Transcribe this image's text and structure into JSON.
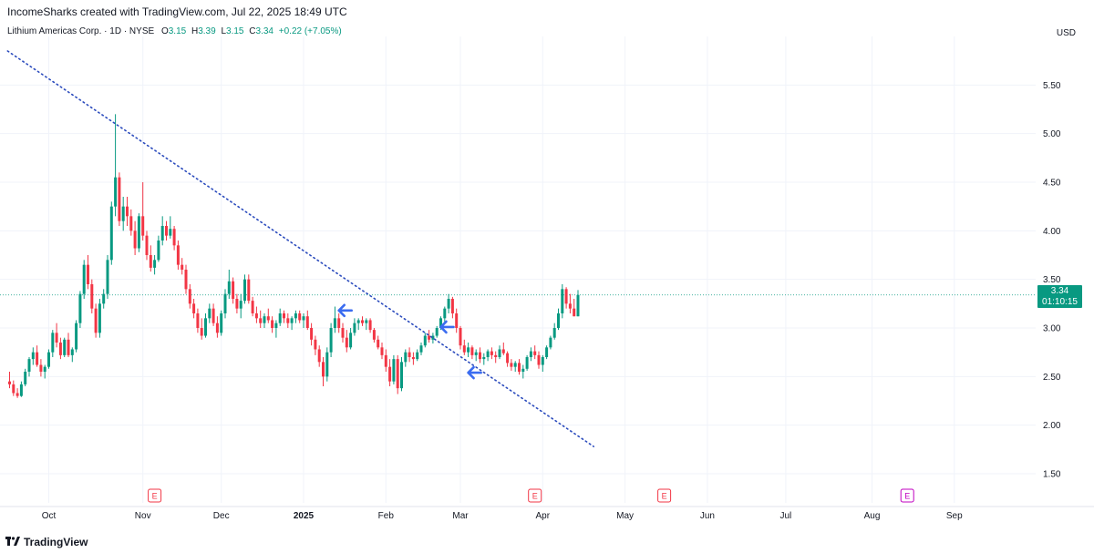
{
  "header": {
    "credit": "IncomeSharks created with TradingView.com, Jul 22, 2025 18:49 UTC",
    "symbol": "Lithium Americas Corp. · 1D · NYSE",
    "o_label": "O",
    "o_value": "3.15",
    "h_label": "H",
    "h_value": "3.39",
    "l_label": "L",
    "l_value": "3.15",
    "c_label": "C",
    "c_value": "3.34",
    "change": "+0.22 (+7.05%)",
    "currency": "USD"
  },
  "price_label": {
    "price": "3.34",
    "countdown": "01:10:15"
  },
  "footer": {
    "brand": "TradingView"
  },
  "colors": {
    "up": "#089981",
    "down": "#f23645",
    "trendline": "#2b4bbd",
    "arrows": "#3b6cf0",
    "earnings": "#f23645",
    "earnings_future": "#c000c0"
  },
  "chart_data": {
    "type": "candlestick",
    "ylim": [
      1.2,
      6.0
    ],
    "y_ticks": [
      "1.50",
      "2.00",
      "2.50",
      "3.00",
      "3.50",
      "4.00",
      "4.50",
      "5.00",
      "5.50"
    ],
    "x_ticks": [
      {
        "label": "Oct",
        "bar": 10
      },
      {
        "label": "Nov",
        "bar": 34
      },
      {
        "label": "Dec",
        "bar": 54
      },
      {
        "label": "2025",
        "bar": 75
      },
      {
        "label": "Feb",
        "bar": 96
      },
      {
        "label": "Mar",
        "bar": 115
      },
      {
        "label": "Apr",
        "bar": 136
      },
      {
        "label": "May",
        "bar": 157
      },
      {
        "label": "Jun",
        "bar": 178
      },
      {
        "label": "Jul",
        "bar": 198
      },
      {
        "label": "Aug",
        "bar": 220
      },
      {
        "label": "Sep",
        "bar": 241
      }
    ],
    "last_price": 3.34,
    "ohlc": [
      [
        2.45,
        2.55,
        2.38,
        2.42
      ],
      [
        2.42,
        2.46,
        2.3,
        2.33
      ],
      [
        2.33,
        2.38,
        2.28,
        2.3
      ],
      [
        2.3,
        2.45,
        2.29,
        2.42
      ],
      [
        2.42,
        2.58,
        2.4,
        2.55
      ],
      [
        2.55,
        2.7,
        2.5,
        2.68
      ],
      [
        2.68,
        2.8,
        2.62,
        2.75
      ],
      [
        2.75,
        2.82,
        2.6,
        2.62
      ],
      [
        2.62,
        2.68,
        2.5,
        2.55
      ],
      [
        2.55,
        2.62,
        2.48,
        2.6
      ],
      [
        2.6,
        2.78,
        2.58,
        2.75
      ],
      [
        2.75,
        2.98,
        2.7,
        2.95
      ],
      [
        2.95,
        3.05,
        2.8,
        2.85
      ],
      [
        2.85,
        2.9,
        2.68,
        2.72
      ],
      [
        2.72,
        2.9,
        2.7,
        2.88
      ],
      [
        2.88,
        2.95,
        2.7,
        2.72
      ],
      [
        2.72,
        2.8,
        2.65,
        2.78
      ],
      [
        2.78,
        3.08,
        2.75,
        3.05
      ],
      [
        3.05,
        3.38,
        3.0,
        3.35
      ],
      [
        3.35,
        3.7,
        3.3,
        3.65
      ],
      [
        3.65,
        3.75,
        3.4,
        3.45
      ],
      [
        3.45,
        3.5,
        3.15,
        3.2
      ],
      [
        3.2,
        3.25,
        2.9,
        2.95
      ],
      [
        2.95,
        3.3,
        2.9,
        3.25
      ],
      [
        3.25,
        3.4,
        3.2,
        3.35
      ],
      [
        3.35,
        3.75,
        3.3,
        3.7
      ],
      [
        3.7,
        4.3,
        3.65,
        4.25
      ],
      [
        4.25,
        5.2,
        4.15,
        4.55
      ],
      [
        4.55,
        4.6,
        4.05,
        4.1
      ],
      [
        4.1,
        4.35,
        4.0,
        4.25
      ],
      [
        4.25,
        4.35,
        4.05,
        4.15
      ],
      [
        4.15,
        4.22,
        3.95,
        4.0
      ],
      [
        4.0,
        4.1,
        3.75,
        3.82
      ],
      [
        3.82,
        4.18,
        3.78,
        4.15
      ],
      [
        4.15,
        4.5,
        3.9,
        3.95
      ],
      [
        3.95,
        4.0,
        3.7,
        3.75
      ],
      [
        3.75,
        3.85,
        3.58,
        3.62
      ],
      [
        3.62,
        3.75,
        3.55,
        3.7
      ],
      [
        3.7,
        3.95,
        3.68,
        3.9
      ],
      [
        3.9,
        4.15,
        3.85,
        4.05
      ],
      [
        4.05,
        4.1,
        3.9,
        3.95
      ],
      [
        3.95,
        4.15,
        3.92,
        4.02
      ],
      [
        4.02,
        4.05,
        3.8,
        3.85
      ],
      [
        3.85,
        3.9,
        3.6,
        3.65
      ],
      [
        3.65,
        3.72,
        3.55,
        3.6
      ],
      [
        3.6,
        3.65,
        3.35,
        3.4
      ],
      [
        3.4,
        3.45,
        3.2,
        3.25
      ],
      [
        3.25,
        3.3,
        3.1,
        3.15
      ],
      [
        3.15,
        3.2,
        2.95,
        3.0
      ],
      [
        3.0,
        3.1,
        2.88,
        2.92
      ],
      [
        2.92,
        3.15,
        2.9,
        3.1
      ],
      [
        3.1,
        3.25,
        3.05,
        3.2
      ],
      [
        3.2,
        3.25,
        3.02,
        3.05
      ],
      [
        3.05,
        3.12,
        2.9,
        2.95
      ],
      [
        2.95,
        3.18,
        2.92,
        3.15
      ],
      [
        3.15,
        3.4,
        3.1,
        3.35
      ],
      [
        3.35,
        3.6,
        3.3,
        3.48
      ],
      [
        3.48,
        3.52,
        3.25,
        3.3
      ],
      [
        3.3,
        3.35,
        3.15,
        3.2
      ],
      [
        3.2,
        3.35,
        3.1,
        3.28
      ],
      [
        3.28,
        3.55,
        3.25,
        3.5
      ],
      [
        3.5,
        3.55,
        3.25,
        3.28
      ],
      [
        3.28,
        3.32,
        3.12,
        3.15
      ],
      [
        3.15,
        3.22,
        3.05,
        3.1
      ],
      [
        3.1,
        3.18,
        3.0,
        3.05
      ],
      [
        3.05,
        3.15,
        3.0,
        3.12
      ],
      [
        3.12,
        3.2,
        3.05,
        3.08
      ],
      [
        3.08,
        3.12,
        2.95,
        3.0
      ],
      [
        3.0,
        3.08,
        2.9,
        3.05
      ],
      [
        3.05,
        3.2,
        3.02,
        3.15
      ],
      [
        3.15,
        3.18,
        3.05,
        3.1
      ],
      [
        3.1,
        3.15,
        3.0,
        3.05
      ],
      [
        3.05,
        3.12,
        2.98,
        3.1
      ],
      [
        3.1,
        3.18,
        3.05,
        3.15
      ],
      [
        3.15,
        3.18,
        3.05,
        3.08
      ],
      [
        3.08,
        3.15,
        3.0,
        3.12
      ],
      [
        3.12,
        3.18,
        2.98,
        3.0
      ],
      [
        3.0,
        3.05,
        2.82,
        2.88
      ],
      [
        2.88,
        2.92,
        2.72,
        2.78
      ],
      [
        2.78,
        2.82,
        2.6,
        2.65
      ],
      [
        2.65,
        2.7,
        2.4,
        2.5
      ],
      [
        2.5,
        2.8,
        2.45,
        2.75
      ],
      [
        2.75,
        3.05,
        2.7,
        3.0
      ],
      [
        3.0,
        3.22,
        2.95,
        3.1
      ],
      [
        3.1,
        3.15,
        2.95,
        3.0
      ],
      [
        3.0,
        3.05,
        2.85,
        2.9
      ],
      [
        2.9,
        2.98,
        2.75,
        2.8
      ],
      [
        2.8,
        3.0,
        2.78,
        2.95
      ],
      [
        2.95,
        3.1,
        2.92,
        3.05
      ],
      [
        3.05,
        3.1,
        2.98,
        3.08
      ],
      [
        3.08,
        3.12,
        3.02,
        3.05
      ],
      [
        3.05,
        3.1,
        2.98,
        3.08
      ],
      [
        3.08,
        3.1,
        2.95,
        2.98
      ],
      [
        2.98,
        3.0,
        2.85,
        2.88
      ],
      [
        2.88,
        2.92,
        2.78,
        2.8
      ],
      [
        2.8,
        2.85,
        2.68,
        2.72
      ],
      [
        2.72,
        2.78,
        2.55,
        2.6
      ],
      [
        2.6,
        2.68,
        2.4,
        2.45
      ],
      [
        2.45,
        2.72,
        2.42,
        2.68
      ],
      [
        2.68,
        2.72,
        2.32,
        2.38
      ],
      [
        2.38,
        2.7,
        2.35,
        2.65
      ],
      [
        2.65,
        2.78,
        2.6,
        2.75
      ],
      [
        2.75,
        2.8,
        2.65,
        2.7
      ],
      [
        2.7,
        2.75,
        2.62,
        2.68
      ],
      [
        2.68,
        2.78,
        2.66,
        2.75
      ],
      [
        2.75,
        2.85,
        2.72,
        2.82
      ],
      [
        2.82,
        2.95,
        2.8,
        2.92
      ],
      [
        2.92,
        2.98,
        2.85,
        2.88
      ],
      [
        2.88,
        2.95,
        2.84,
        2.92
      ],
      [
        2.92,
        3.02,
        2.9,
        3.0
      ],
      [
        3.0,
        3.12,
        2.98,
        3.1
      ],
      [
        3.1,
        3.22,
        3.05,
        3.2
      ],
      [
        3.2,
        3.35,
        3.15,
        3.3
      ],
      [
        3.3,
        3.32,
        3.1,
        3.15
      ],
      [
        3.15,
        3.2,
        2.95,
        3.0
      ],
      [
        3.0,
        3.02,
        2.78,
        2.82
      ],
      [
        2.82,
        2.88,
        2.72,
        2.75
      ],
      [
        2.75,
        2.85,
        2.7,
        2.8
      ],
      [
        2.8,
        2.82,
        2.68,
        2.72
      ],
      [
        2.72,
        2.78,
        2.66,
        2.75
      ],
      [
        2.75,
        2.8,
        2.64,
        2.68
      ],
      [
        2.68,
        2.74,
        2.62,
        2.7
      ],
      [
        2.7,
        2.78,
        2.66,
        2.76
      ],
      [
        2.76,
        2.8,
        2.68,
        2.72
      ],
      [
        2.72,
        2.76,
        2.64,
        2.7
      ],
      [
        2.7,
        2.82,
        2.68,
        2.78
      ],
      [
        2.78,
        2.85,
        2.72,
        2.74
      ],
      [
        2.74,
        2.76,
        2.6,
        2.64
      ],
      [
        2.64,
        2.68,
        2.56,
        2.6
      ],
      [
        2.6,
        2.66,
        2.55,
        2.64
      ],
      [
        2.64,
        2.68,
        2.52,
        2.55
      ],
      [
        2.55,
        2.62,
        2.48,
        2.58
      ],
      [
        2.58,
        2.72,
        2.56,
        2.7
      ],
      [
        2.7,
        2.8,
        2.66,
        2.76
      ],
      [
        2.76,
        2.82,
        2.68,
        2.72
      ],
      [
        2.72,
        2.76,
        2.58,
        2.62
      ],
      [
        2.62,
        2.72,
        2.55,
        2.7
      ],
      [
        2.7,
        2.82,
        2.68,
        2.8
      ],
      [
        2.8,
        2.92,
        2.78,
        2.9
      ],
      [
        2.9,
        3.05,
        2.88,
        3.0
      ],
      [
        3.0,
        3.2,
        2.98,
        3.15
      ],
      [
        3.15,
        3.45,
        3.1,
        3.4
      ],
      [
        3.4,
        3.42,
        3.2,
        3.25
      ],
      [
        3.25,
        3.35,
        3.15,
        3.2
      ],
      [
        3.2,
        3.3,
        3.12,
        3.12
      ],
      [
        3.12,
        3.39,
        3.12,
        3.34
      ]
    ],
    "bar_x0": 10.5,
    "bar_dx": 4.3,
    "trendline": {
      "from": [
        -0.5,
        5.85
      ],
      "to": [
        149,
        1.78
      ]
    },
    "arrows": [
      {
        "bar": 84,
        "price": 3.18
      },
      {
        "bar": 110,
        "price": 3.01
      },
      {
        "bar": 117,
        "price": 2.54
      }
    ],
    "earnings_markers": [
      {
        "label": "E",
        "bar": 37,
        "future": false
      },
      {
        "label": "E",
        "bar": 134,
        "future": false
      },
      {
        "label": "E",
        "bar": 167,
        "future": false
      },
      {
        "label": "E",
        "bar": 229,
        "future": true
      }
    ]
  }
}
